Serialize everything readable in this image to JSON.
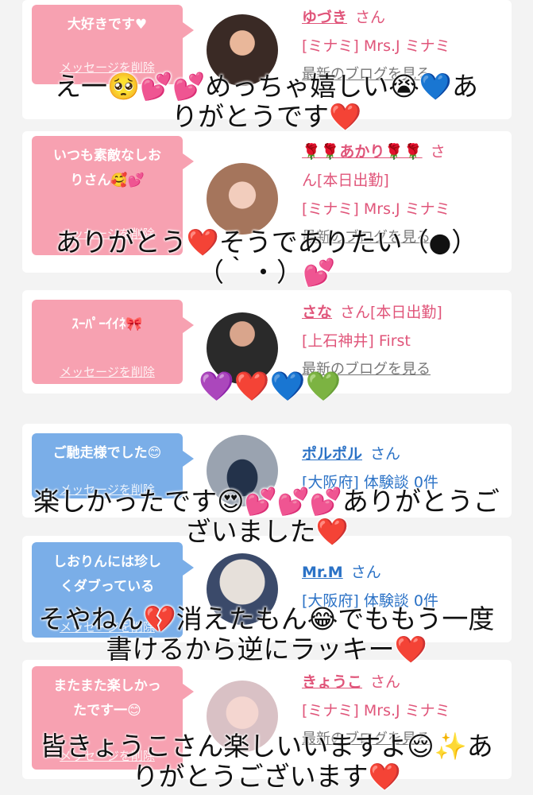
{
  "cards": [
    {
      "message": "大好きです♥",
      "delete": "メッセージを削除",
      "name": "ゆづき",
      "san": "さん",
      "area": "[ミナミ] Mrs.J ミナミ",
      "blog": "最新のブログを見る"
    },
    {
      "message_line1": "いつも素敵なしお",
      "message_line2": "りさん🥰💕",
      "delete": "メッセージを削除",
      "name": "🌹🌹あかり🌹🌹",
      "san": "さ",
      "status": "ん[本日出勤]",
      "area": "[ミナミ] Mrs.J ミナミ",
      "blog": "最新のブログを見る"
    },
    {
      "message": "ｽｰﾊﾟｰｲｲﾈ🎀",
      "delete": "メッセージを削除",
      "name": "さな",
      "san": "さん[本日出勤]",
      "area": "[上石神井] First",
      "blog": "最新のブログを見る"
    },
    {
      "message": "ご馳走様でした😊",
      "delete": "メッセージを削除",
      "name": "ポルポル",
      "san": "さん",
      "area": "[大阪府] 体験談 0件"
    },
    {
      "message_line1": "しおりんには珍し",
      "message_line2": "くダブっている",
      "delete": "メッセージを削除",
      "name": "Mr.M",
      "san": "さん",
      "area": "[大阪府] 体験談 0件"
    },
    {
      "message_line1": "またまた楽しかっ",
      "message_line2": "たです一😊",
      "delete": "メッセージを削除",
      "name": "きょうこ",
      "san": "さん",
      "area": "[ミナミ] Mrs.J ミナミ",
      "blog": "最新のブログを見る"
    }
  ],
  "captions": [
    {
      "line1": "え一🥺💕💕めっちゃ嬉しい😭💙あ",
      "line2": "りがとうです❤️"
    },
    {
      "line1": "ありがとう❤️そうでありたい（●）",
      "line2": "（｀・）💕"
    },
    {
      "line1": "💜❤️💙💚"
    },
    {
      "line1": "楽しかったです😍💕💕💕ありがとうご",
      "line2": "ざいました❤️"
    },
    {
      "line1": "そやねん💔消えたもん😂でももう一度",
      "line2": "書けるから逆にラッキー❤️"
    },
    {
      "line1": "皆きょうこさん楽しいいますよ😌✨あ",
      "line2": "りがとうございます❤️"
    }
  ],
  "colors": {
    "pink_bubble": "#f7a1b1",
    "blue_bubble": "#7aaee8",
    "pink_text": "#e0557a",
    "blue_text": "#2b72c6"
  }
}
